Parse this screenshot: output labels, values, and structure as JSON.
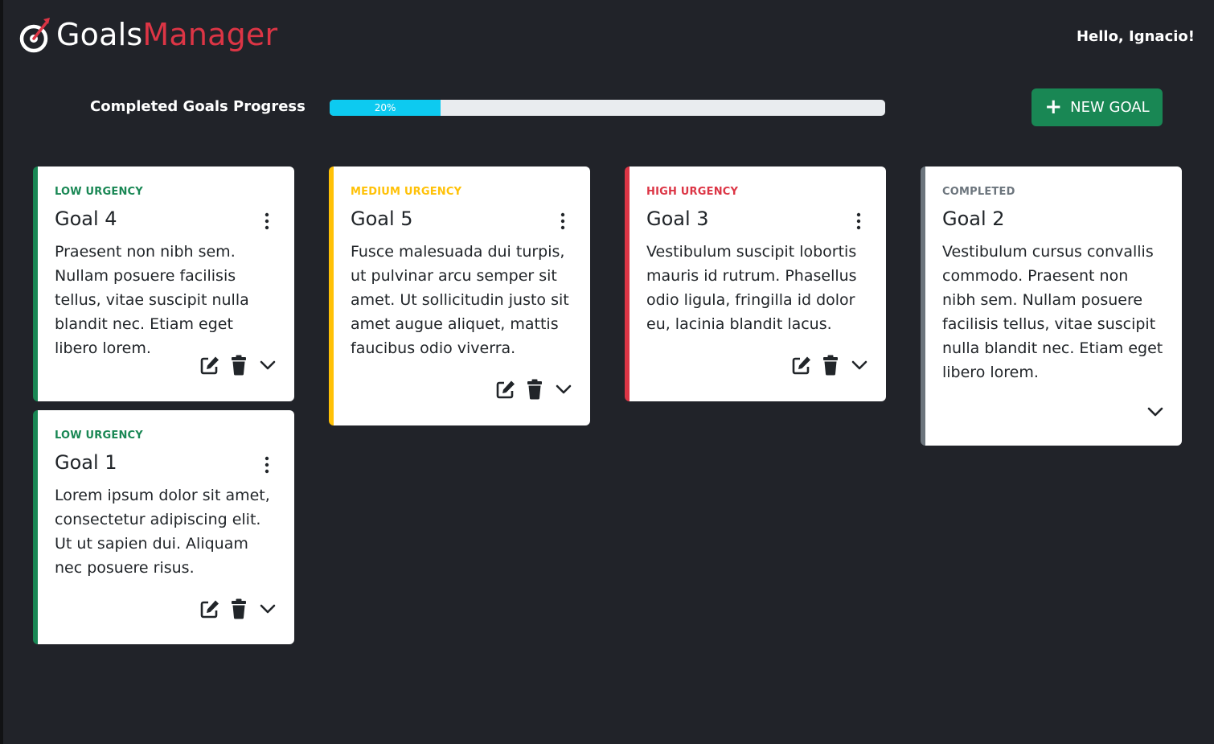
{
  "header": {
    "brand_part1": "Goals",
    "brand_part2": "Manager",
    "greeting": "Hello, Ignacio!"
  },
  "progress": {
    "label": "Completed Goals Progress",
    "value_text": "20%",
    "fraction": 0.2
  },
  "new_goal_button": {
    "label": "NEW GOAL",
    "icon": "plus-icon"
  },
  "colors": {
    "background": "#212329",
    "low": "#198754",
    "medium": "#ffc107",
    "high": "#dc3545",
    "completed": "#6c757d",
    "progress": "#0dcaf0"
  },
  "goals": [
    {
      "status": "LOW URGENCY",
      "title": "Goal 4",
      "description": "Praesent non nibh sem. Nullam posuere facilisis tellus, vitae suscipit nulla blandit nec. Etiam eget libero lorem."
    },
    {
      "status": "LOW URGENCY",
      "title": "Goal 1",
      "description": "Lorem ipsum dolor sit amet, consectetur adipiscing elit. Ut ut sapien dui. Aliquam nec posuere risus."
    },
    {
      "status": "MEDIUM URGENCY",
      "title": "Goal 5",
      "description": "Fusce malesuada dui turpis, ut pulvinar arcu semper sit amet. Ut sollicitudin justo sit amet augue aliquet, mattis faucibus odio viverra."
    },
    {
      "status": "HIGH URGENCY",
      "title": "Goal 3",
      "description": "Vestibulum suscipit lobortis mauris id rutrum. Phasellus odio ligula, fringilla id dolor eu, lacinia blandit lacus."
    },
    {
      "status": "COMPLETED",
      "title": "Goal 2",
      "description": "Vestibulum cursus convallis commodo. Praesent non nibh sem. Nullam posuere facilisis tellus, vitae suscipit nulla blandit nec. Etiam eget libero lorem."
    }
  ]
}
